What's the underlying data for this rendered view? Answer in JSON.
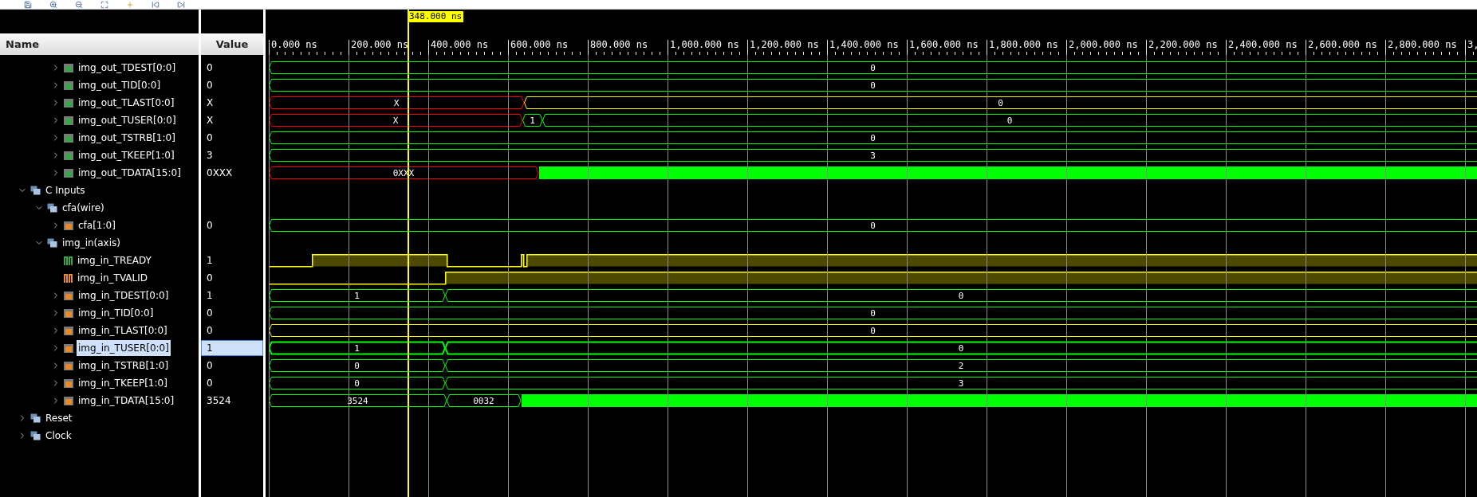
{
  "cursor": {
    "label": "348.000 ns"
  },
  "ruler": [
    "0.000 ns",
    "200.000 ns",
    "400.000 ns",
    "600.000 ns",
    "800.000 ns",
    "1,000.000 ns",
    "1,200.000 ns",
    "1,400.000 ns",
    "1,600.000 ns",
    "1,800.000 ns",
    "2,000.000 ns",
    "2,200.000 ns",
    "2,400.000 ns",
    "2,600.000 ns",
    "2,800.000 ns",
    "3,"
  ],
  "columns": {
    "name": "Name",
    "value": "Value"
  },
  "tree": {
    "continued_items": [
      {
        "kind": "bus",
        "name": "img_out_TDEST[0:0]",
        "value": "0",
        "color": "#3aa84a",
        "expanded": false,
        "selected": false,
        "segments": [
          {
            "kind": "value",
            "label": "0",
            "color": "#00ff00"
          }
        ]
      },
      {
        "kind": "bus",
        "name": "img_out_TID[0:0]",
        "value": "0",
        "color": "#3aa84a",
        "expanded": false,
        "selected": false,
        "segments": [
          {
            "kind": "value",
            "label": "0",
            "color": "#00ff00"
          }
        ]
      },
      {
        "kind": "bus",
        "name": "img_out_TLAST[0:0]",
        "value": "X",
        "color": "#3aa84a",
        "expanded": false,
        "selected": false,
        "segments": [
          {
            "kind": "value",
            "label": "X",
            "color": "#ff0000"
          },
          {
            "kind": "value",
            "label": "0",
            "color": "#ffff00"
          }
        ]
      },
      {
        "kind": "bus",
        "name": "img_out_TUSER[0:0]",
        "value": "X",
        "color": "#3aa84a",
        "expanded": false,
        "selected": false,
        "segments": [
          {
            "kind": "value",
            "label": "X",
            "color": "#ff0000"
          },
          {
            "kind": "value",
            "label": "1",
            "color": "#00ff00"
          },
          {
            "kind": "value",
            "label": "0",
            "color": "#00ff00"
          }
        ]
      },
      {
        "kind": "bus",
        "name": "img_out_TSTRB[1:0]",
        "value": "0",
        "color": "#3aa84a",
        "expanded": false,
        "selected": false,
        "segments": [
          {
            "kind": "value",
            "label": "0",
            "color": "#00ff00"
          }
        ]
      },
      {
        "kind": "bus",
        "name": "img_out_TKEEP[1:0]",
        "value": "3",
        "color": "#3aa84a",
        "expanded": false,
        "selected": false,
        "segments": [
          {
            "kind": "value",
            "label": "3",
            "color": "#00ff00"
          }
        ]
      },
      {
        "kind": "bus",
        "name": "img_out_TDATA[15:0]",
        "value": "0XXX",
        "color": "#3aa84a",
        "expanded": false,
        "selected": false,
        "segments": [
          {
            "kind": "value",
            "label": "0XXX",
            "color": "#ff0000"
          },
          {
            "kind": "dense",
            "color": "#00ff00"
          }
        ]
      }
    ],
    "items": [
      {
        "kind": "group",
        "name": "C Inputs",
        "expanded": true,
        "selected": false,
        "children": [
          {
            "kind": "group",
            "name": "cfa(wire)",
            "expanded": true,
            "selected": false,
            "children": [
              {
                "kind": "bus",
                "name": "cfa[1:0]",
                "value": "0",
                "color": "#e8892a",
                "expanded": false,
                "selected": false,
                "segments": [
                  {
                    "kind": "value",
                    "label": "0",
                    "color": "#00ff00"
                  }
                ]
              }
            ]
          },
          {
            "kind": "group",
            "name": "img_in(axis)",
            "expanded": true,
            "selected": false,
            "children": [
              {
                "kind": "bit",
                "name": "img_in_TREADY",
                "value": "1",
                "color": "#3aa84a",
                "selected": false,
                "segments": [
                  {
                    "kind": "low",
                    "color": "#ffff00"
                  },
                  {
                    "kind": "high",
                    "color": "#ffff00"
                  },
                  {
                    "kind": "low",
                    "color": "#ffff00"
                  },
                  {
                    "kind": "high",
                    "color": "#ffff00"
                  },
                  {
                    "kind": "low",
                    "color": "#ffff00"
                  },
                  {
                    "kind": "high",
                    "color": "#ffff00"
                  }
                ]
              },
              {
                "kind": "bit",
                "name": "img_in_TVALID",
                "value": "0",
                "color": "#e8892a",
                "selected": false,
                "segments": [
                  {
                    "kind": "low",
                    "color": "#ffff00"
                  },
                  {
                    "kind": "high",
                    "color": "#ffff00"
                  }
                ]
              },
              {
                "kind": "bus",
                "name": "img_in_TDEST[0:0]",
                "value": "1",
                "color": "#e8892a",
                "expanded": false,
                "selected": false,
                "segments": [
                  {
                    "kind": "value",
                    "label": "1",
                    "color": "#00ff00"
                  },
                  {
                    "kind": "value",
                    "label": "0",
                    "color": "#00ff00"
                  }
                ]
              },
              {
                "kind": "bus",
                "name": "img_in_TID[0:0]",
                "value": "0",
                "color": "#e8892a",
                "expanded": false,
                "selected": false,
                "segments": [
                  {
                    "kind": "value",
                    "label": "0",
                    "color": "#00ff00"
                  }
                ]
              },
              {
                "kind": "bus",
                "name": "img_in_TLAST[0:0]",
                "value": "0",
                "color": "#e8892a",
                "expanded": false,
                "selected": false,
                "segments": [
                  {
                    "kind": "value",
                    "label": "0",
                    "color": "#ffff00"
                  }
                ]
              },
              {
                "kind": "bus",
                "name": "img_in_TUSER[0:0]",
                "value": "1",
                "color": "#e8892a",
                "expanded": false,
                "selected": true,
                "segments": [
                  {
                    "kind": "value",
                    "label": "1",
                    "color": "#00ff00"
                  },
                  {
                    "kind": "value",
                    "label": "0",
                    "color": "#00ff00"
                  }
                ]
              },
              {
                "kind": "bus",
                "name": "img_in_TSTRB[1:0]",
                "value": "0",
                "color": "#e8892a",
                "expanded": false,
                "selected": false,
                "segments": [
                  {
                    "kind": "value",
                    "label": "0",
                    "color": "#00ff00"
                  },
                  {
                    "kind": "value",
                    "label": "2",
                    "color": "#00ff00"
                  }
                ]
              },
              {
                "kind": "bus",
                "name": "img_in_TKEEP[1:0]",
                "value": "0",
                "color": "#e8892a",
                "expanded": false,
                "selected": false,
                "segments": [
                  {
                    "kind": "value",
                    "label": "0",
                    "color": "#00ff00"
                  },
                  {
                    "kind": "value",
                    "label": "3",
                    "color": "#00ff00"
                  }
                ]
              },
              {
                "kind": "bus",
                "name": "img_in_TDATA[15:0]",
                "value": "3524",
                "color": "#e8892a",
                "expanded": false,
                "selected": false,
                "segments": [
                  {
                    "kind": "value",
                    "label": "3524",
                    "color": "#00ff00"
                  },
                  {
                    "kind": "value",
                    "label": "0032",
                    "color": "#00ff00"
                  },
                  {
                    "kind": "dense",
                    "color": "#00ff00"
                  }
                ]
              }
            ]
          }
        ]
      },
      {
        "kind": "group",
        "name": "Reset",
        "expanded": false,
        "selected": false
      },
      {
        "kind": "group",
        "name": "Clock",
        "expanded": false,
        "selected": false
      }
    ]
  }
}
